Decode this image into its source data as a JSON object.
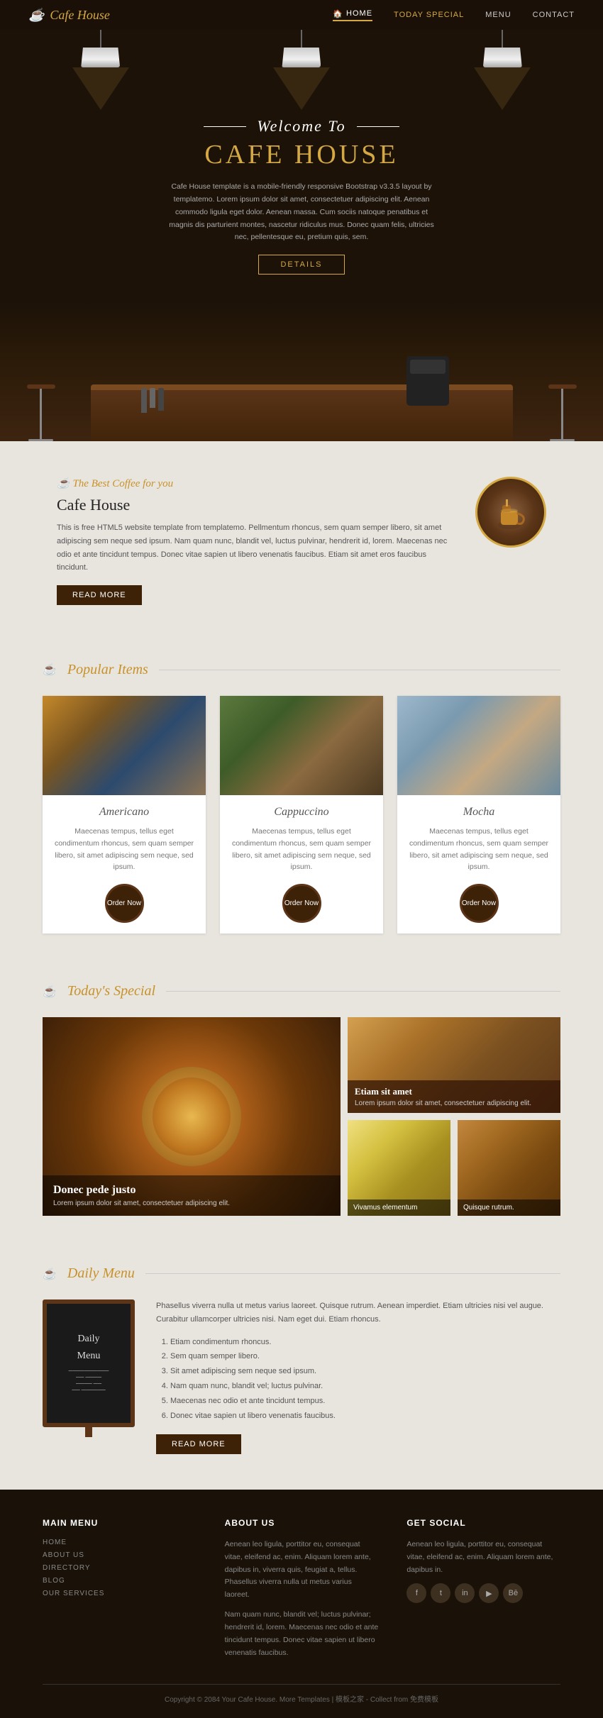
{
  "navbar": {
    "brand": "Cafe House",
    "cup_icon": "☕",
    "menu_items": [
      {
        "label": "HOME",
        "active": true,
        "has_icon": true
      },
      {
        "label": "TODAY SPECIAL",
        "special": true
      },
      {
        "label": "MENU"
      },
      {
        "label": "CONTACT"
      }
    ]
  },
  "hero": {
    "welcome_text": "Welcome To",
    "title": "CAFE HOUSE",
    "description": "Cafe House template is a mobile-friendly responsive Bootstrap v3.3.5 layout by templatemo. Lorem ipsum dolor sit amet, consectetuer adipiscing elit. Aenean commodo ligula eget dolor. Aenean massa. Cum sociis natoque penatibus et magnis dis parturient montes, nascetur ridiculus mus. Donec quam felis, ultricies nec, pellentesque eu, pretium quis, sem.",
    "template_link": "templatemo",
    "details_btn": "DETAILS"
  },
  "about": {
    "subtitle": "The Best Coffee for you",
    "title": "Cafe House",
    "description": "This is free HTML5 website template from templatemo. Pellmentum rhoncus, sem quam semper libero, sit amet adipiscing sem neque sed ipsum. Nam quam nunc, blandit vel, luctus pulvinar, hendrerit id, lorem. Maecenas nec odio et ante tincidunt tempus. Donec vitae sapien ut libero venenatis faucibus. Etiam sit amet eros faucibus tincidunt.",
    "template_link": "templatemo",
    "read_more_btn": "READ MORE"
  },
  "popular": {
    "section_title": "Popular Items",
    "cup_icon": "☕",
    "items": [
      {
        "name": "Americano",
        "description": "Maecenas tempus, tellus eget condimentum rhoncus, sem quam semper libero, sit amet adipiscing sem neque, sed ipsum.",
        "order_btn": "Order Now"
      },
      {
        "name": "Cappuccino",
        "description": "Maecenas tempus, tellus eget condimentum rhoncus, sem quam semper libero, sit amet adipiscing sem neque, sed ipsum.",
        "order_btn": "Order Now"
      },
      {
        "name": "Mocha",
        "description": "Maecenas tempus, tellus eget condimentum rhoncus, sem quam semper libero, sit amet adipiscing sem neque, sed ipsum.",
        "order_btn": "Order Now"
      }
    ]
  },
  "todays_special": {
    "section_title": "Today's Special",
    "cup_icon": "☕",
    "main_item": {
      "title": "Donec pede justo",
      "description": "Lorem ipsum dolor sit amet, consectetuer adipiscing elit."
    },
    "side_items": [
      {
        "title": "Etiam sit amet",
        "description": "Lorem ipsum dolor sit amet, consectetuer adipiscing elit."
      },
      {
        "label": "Vivamus elementum"
      },
      {
        "label": "Quisque rutrum."
      }
    ]
  },
  "daily_menu": {
    "section_title": "Daily Menu",
    "cup_icon": "☕",
    "chalkboard_text": "Daily Menu",
    "description": "Phasellus viverra nulla ut metus varius laoreet. Quisque rutrum. Aenean imperdiet. Etiam ultricies nisi vel augue. Curabitur ullamcorper ultricies nisi. Nam eget dui. Etiam rhoncus.",
    "list_items": [
      "Etiam condimentum rhoncus.",
      "Sem quam semper libero.",
      "Sit amet adipiscing sem neque sed ipsum.",
      "Nam quam nunc, blandit vel; luctus pulvinar.",
      "Maecenas nec odio et ante tincidunt tempus.",
      "Donec vitae sapien ut libero venenatis faucibus."
    ],
    "read_more_btn": "READ MORE"
  },
  "footer": {
    "main_menu_title": "MAIN MENU",
    "main_menu_items": [
      {
        "label": "HOME"
      },
      {
        "label": "ABOUT US"
      },
      {
        "label": "DIRECTORY"
      },
      {
        "label": "BLOG"
      },
      {
        "label": "OUR SERVICES"
      }
    ],
    "about_title": "About Us",
    "about_text1": "Aenean leo ligula, porttitor eu, consequat vitae, eleifend ac, enim. Aliquam lorem ante, dapibus in, viverra quis, feugiat a, tellus. Phasellus viverra nulla ut metus varius laoreet.",
    "about_text2": "Nam quam nunc, blandit vel; luctus pulvinar; hendrerit id, lorem. Maecenas nec odio et ante tincidunt tempus. Donec vitae sapien ut libero venenatis faucibus.",
    "social_title": "Get Social",
    "social_text": "Aenean leo ligula, porttitor eu, consequat vitae, eleifend ac, enim. Aliquam lorem ante, dapibus in.",
    "social_icons": [
      "f",
      "t",
      "in",
      "yt",
      "be"
    ],
    "copyright": "Copyright © 2084 Your Cafe House. More Templates | 模板之家 - Collect from 免费模板"
  }
}
